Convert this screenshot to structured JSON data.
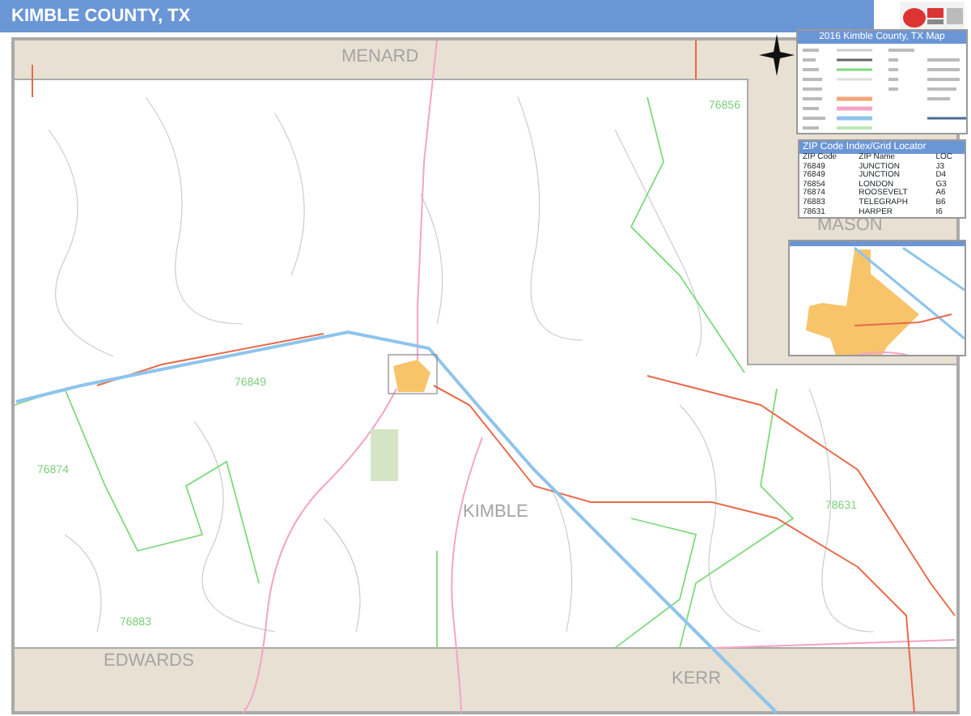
{
  "title": "KIMBLE COUNTY, TX",
  "map_labels": [
    {
      "text": "MENARD",
      "kind": "county"
    },
    {
      "text": "MASON",
      "kind": "county"
    },
    {
      "text": "KIMBLE",
      "kind": "county"
    },
    {
      "text": "EDWARDS",
      "kind": "county"
    },
    {
      "text": "KERR",
      "kind": "county"
    },
    {
      "text": "76856",
      "kind": "zip"
    },
    {
      "text": "76849",
      "kind": "zip"
    },
    {
      "text": "76874",
      "kind": "zip"
    },
    {
      "text": "76883",
      "kind": "zip"
    },
    {
      "text": "78631",
      "kind": "zip"
    }
  ],
  "legend": {
    "title": "2016 Kimble County, TX Map"
  },
  "zip_table": {
    "title": "ZIP Code Index/Grid Locator",
    "columns": [
      "ZIP Code",
      "ZIP Name",
      "LOC"
    ],
    "rows": [
      [
        "76849",
        "JUNCTION",
        "J3"
      ],
      [
        "76849",
        "JUNCTION",
        "D4"
      ],
      [
        "76854",
        "LONDON",
        "G3"
      ],
      [
        "76874",
        "ROOSEVELT",
        "A6"
      ],
      [
        "76883",
        "TELEGRAPH",
        "B6"
      ],
      [
        "78631",
        "HARPER",
        "I6"
      ]
    ]
  }
}
